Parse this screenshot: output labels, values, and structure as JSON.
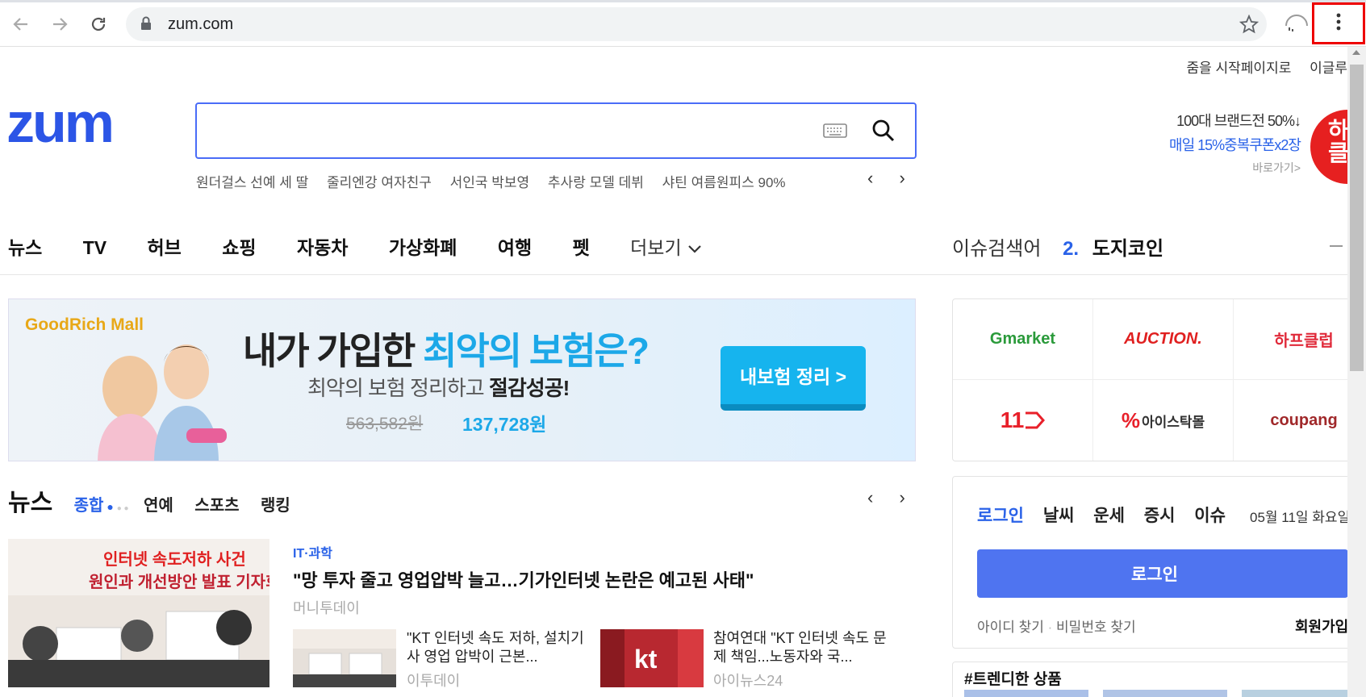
{
  "browser": {
    "url": "zum.com",
    "icons": [
      "back-icon",
      "forward-icon",
      "reload-icon",
      "lock-icon",
      "star-icon",
      "profile-icon",
      "more-vert-icon"
    ]
  },
  "top_links": {
    "start_page": "줌을 시작페이지로",
    "more": "이글루"
  },
  "logo_text": "zum",
  "search": {
    "placeholder": ""
  },
  "trending": [
    "원더걸스 선예 세 딸",
    "줄리엔강 여자친구",
    "서인국 박보영",
    "추사랑 모델 데뷔",
    "샤틴 여름원피스 90%"
  ],
  "promo": {
    "line1": "100대 브랜드전 50%↓",
    "line2": "매일 15%중복쿠폰x2장",
    "link": "바로가기>",
    "badge": "하프 클"
  },
  "menu": [
    "뉴스",
    "TV",
    "허브",
    "쇼핑",
    "자동차",
    "가상화폐",
    "여행",
    "펫"
  ],
  "menu_more": "더보기",
  "issue": {
    "label": "이슈검색어",
    "rank": "2.",
    "keyword": "도지코인"
  },
  "banner": {
    "brand": "GoodRich Mall",
    "headline_a": "내가 가입한 ",
    "headline_b": "최악의 보험은?",
    "sub_a": "최악의 보험 정리하고 ",
    "sub_b": "절감성공!",
    "old_price": "563,582원",
    "new_price": "137,728원",
    "cta": "내보험 정리 >"
  },
  "shops": [
    "Gmarket",
    "AUCTION.",
    "하프클럽",
    "11",
    "아이스탁몰",
    "coupang"
  ],
  "news": {
    "title": "뉴스",
    "tabs": [
      "종합",
      "연예",
      "스포츠",
      "랭킹"
    ],
    "category": "IT·과학",
    "headline": "\"망 투자 줄고 영업압박 늘고…기가인터넷 논란은 예고된 사태\"",
    "source": "머니투데이",
    "photo_text_1": "인터넷 속도저하 사건",
    "photo_text_2": "원인과 개선방안 발표 기자회",
    "items": [
      {
        "title": "\"KT 인터넷 속도 저하, 설치기사 영업 압박이 근본...",
        "source": "이투데이"
      },
      {
        "title": "참여연대 \"KT 인터넷 속도 문제 책임...노동자와 국...",
        "source": "아이뉴스24"
      }
    ]
  },
  "login_panel": {
    "tabs": [
      "로그인",
      "날씨",
      "운세",
      "증시",
      "이슈"
    ],
    "date": "05월 11일 화요일",
    "button": "로그인",
    "find_id": "아이디 찾기",
    "find_pw": "비밀번호 찾기",
    "join": "회원가입"
  },
  "trend": {
    "title": "#트렌디한 상품"
  },
  "colors": {
    "brand_blue": "#2a62e8",
    "logo_blue": "#2c55e6",
    "login_button": "#4f74f0",
    "badge_red": "#e62020"
  }
}
